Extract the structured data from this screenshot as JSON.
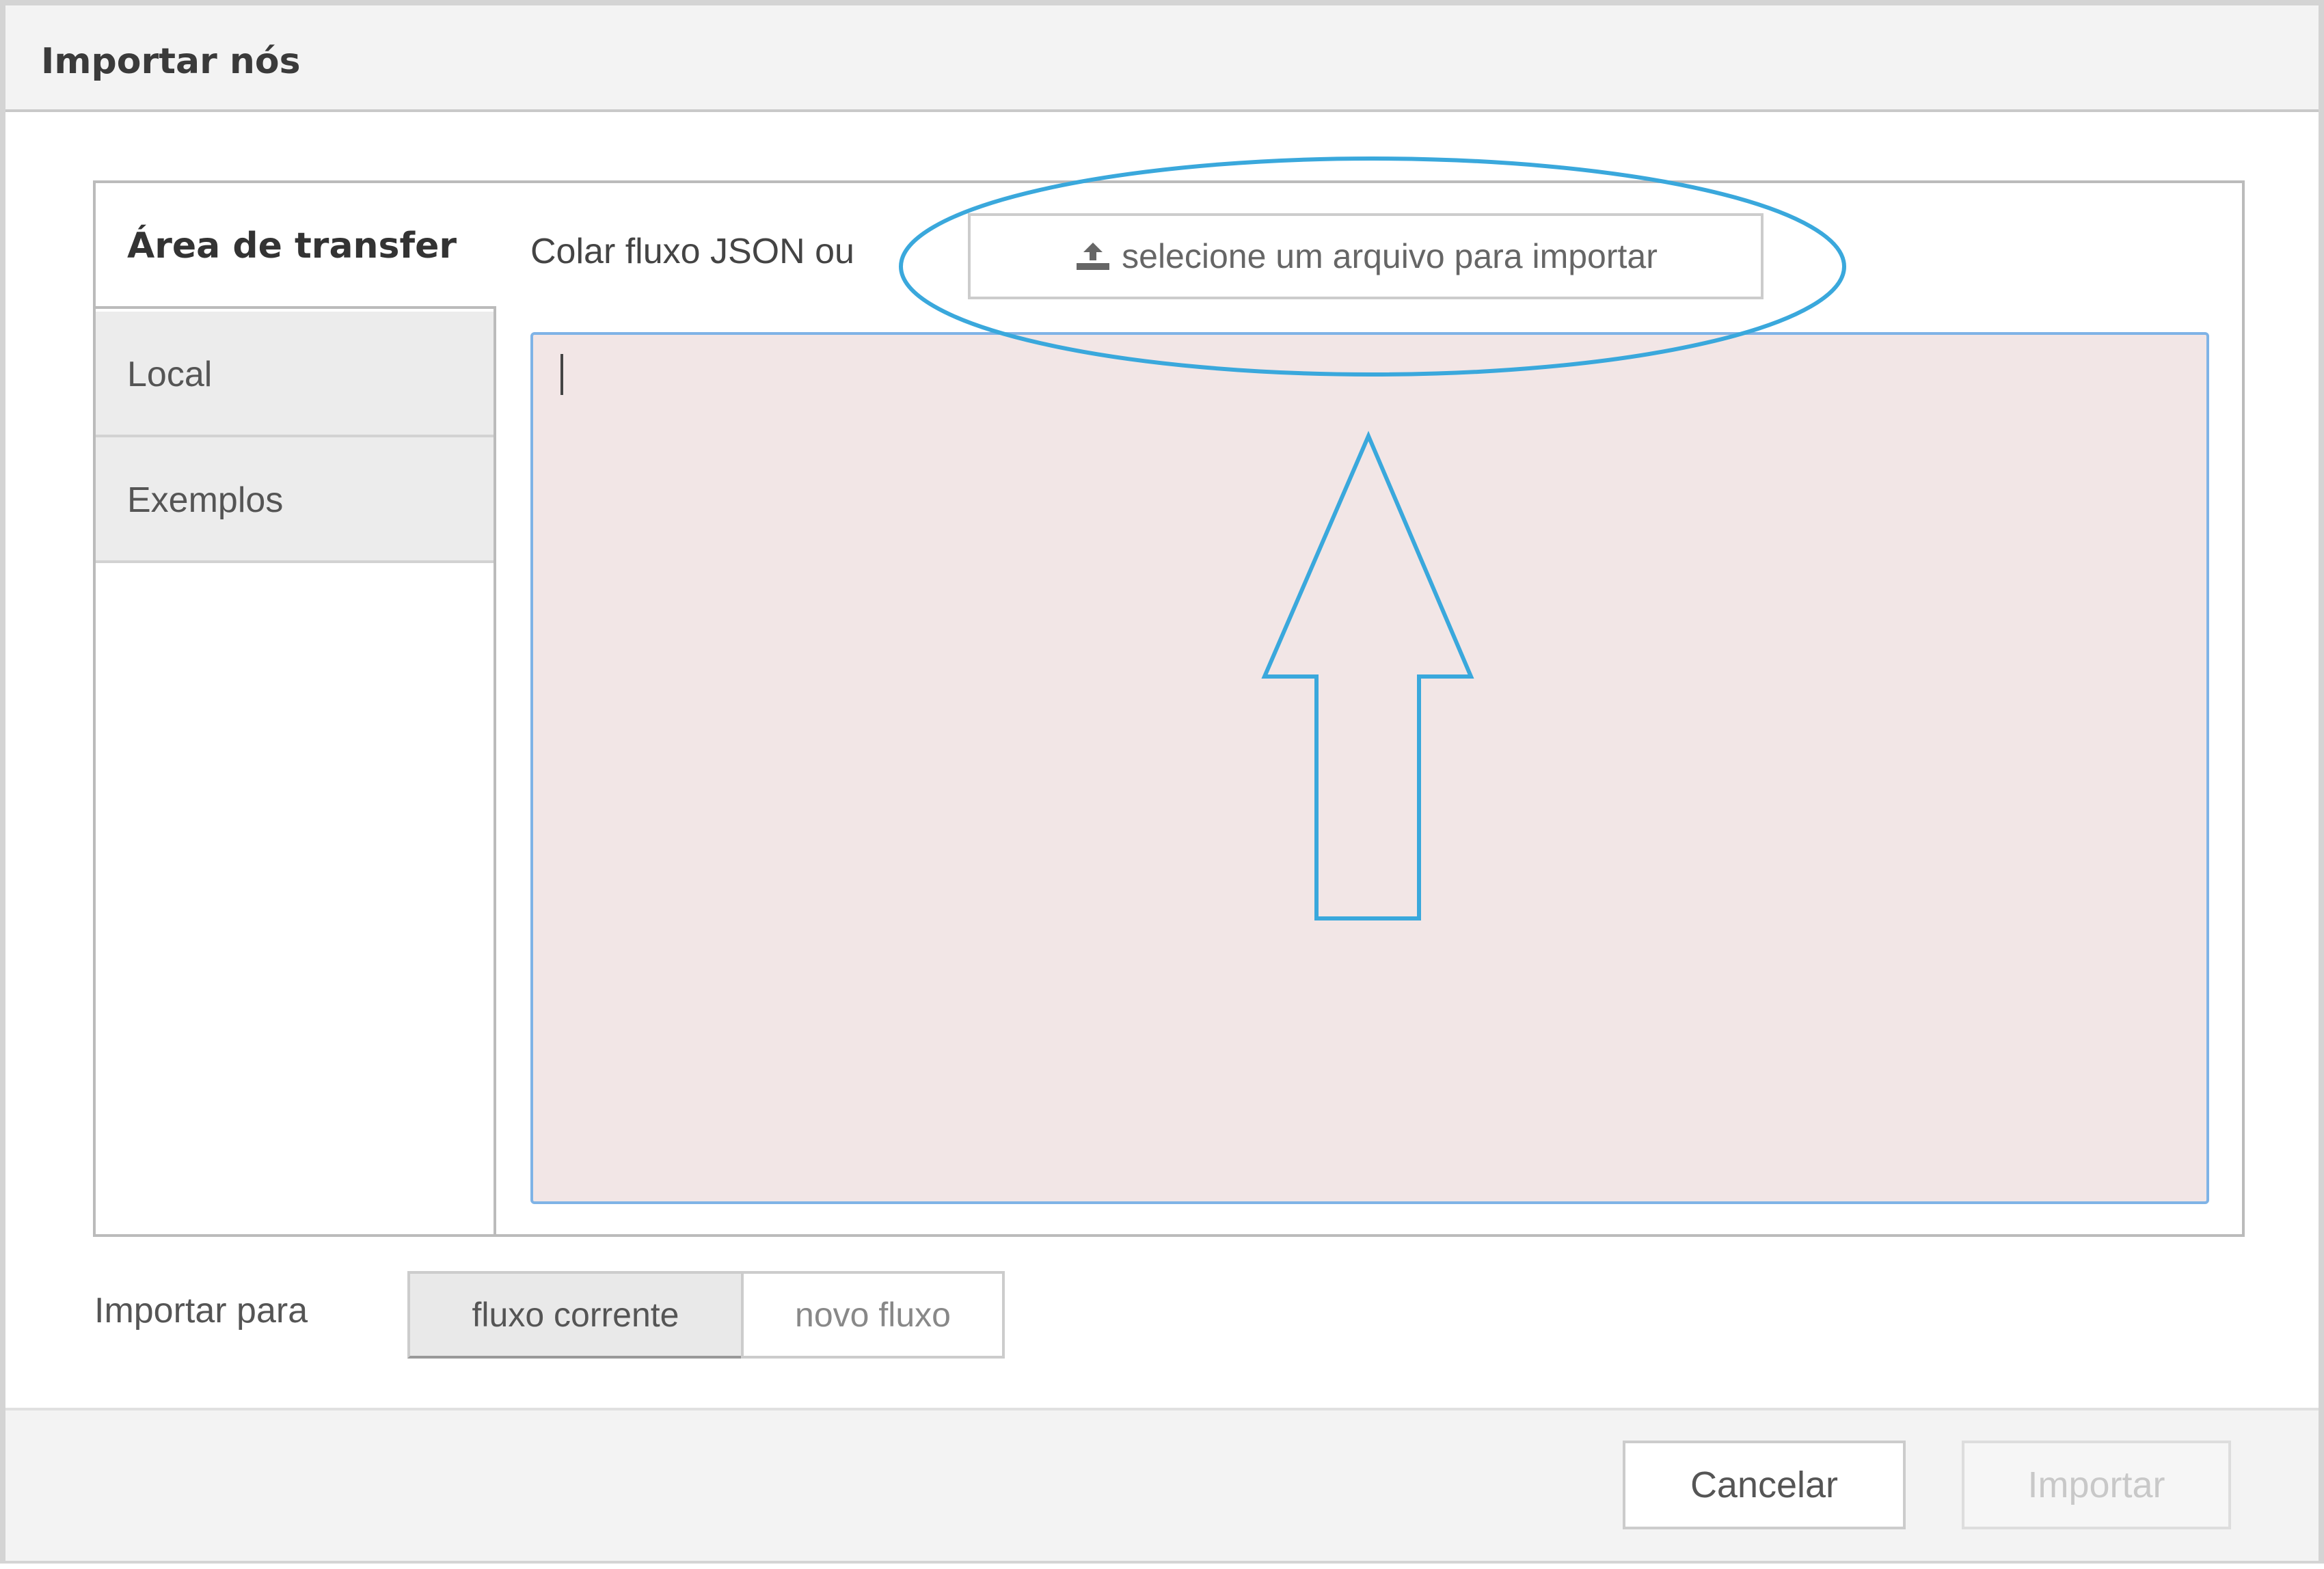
{
  "dialog": {
    "title": "Importar nós"
  },
  "tabs": [
    {
      "label": "Área de transfer",
      "active": true
    },
    {
      "label": "Local",
      "active": false
    },
    {
      "label": "Exemplos",
      "active": false
    }
  ],
  "clipboard": {
    "paste_label": "Colar fluxo JSON ou",
    "upload_icon": "upload-icon",
    "upload_label": "selecione um arquivo para importar",
    "json_value": ""
  },
  "import_target": {
    "label": "Importar para",
    "options": [
      "fluxo corrente",
      "novo fluxo"
    ],
    "selected": "fluxo corrente"
  },
  "footer": {
    "cancel_label": "Cancelar",
    "import_label": "Importar"
  },
  "annotation": {
    "color": "#3aa8dc",
    "shapes": [
      "highlight-ellipse",
      "pointer-arrow"
    ]
  },
  "colors": {
    "textarea_bg": "#f2e6e6",
    "textarea_border": "#7fb3e6"
  }
}
